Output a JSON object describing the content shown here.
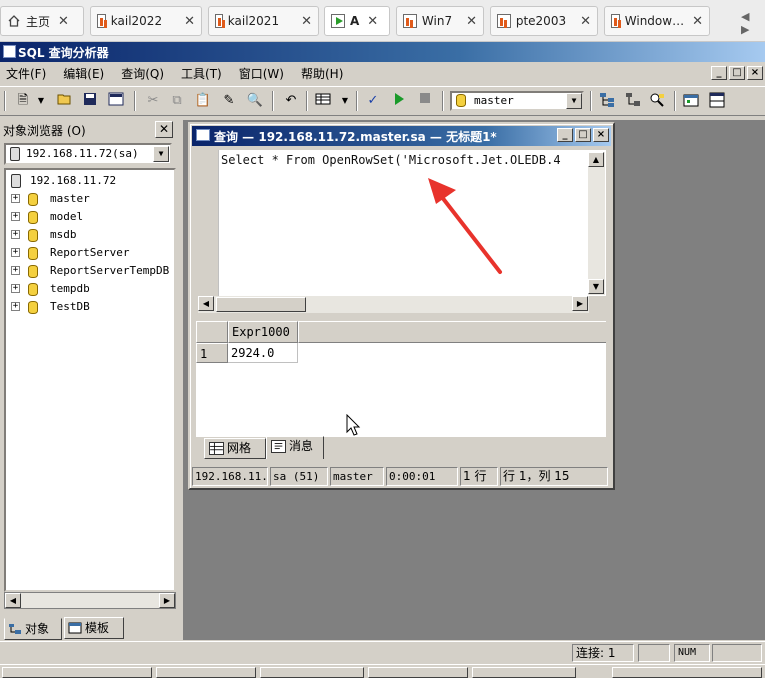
{
  "browser_tabs": [
    {
      "label": "主页",
      "icon": "home-icon",
      "active": false
    },
    {
      "label": "kail2022",
      "icon": "vm-icon",
      "active": false
    },
    {
      "label": "kail2021",
      "icon": "vm-icon",
      "active": false
    },
    {
      "label": "A",
      "icon": "play-icon",
      "active": true
    },
    {
      "label": "Win7",
      "icon": "vm-icon",
      "active": false
    },
    {
      "label": "pte2003",
      "icon": "vm-icon",
      "active": false
    },
    {
      "label": "Window…",
      "icon": "vm-icon",
      "active": false
    }
  ],
  "app": {
    "title": "SQL 查询分析器",
    "window_buttons": [
      "_",
      "□",
      "×"
    ]
  },
  "menu": [
    "文件(F)",
    "编辑(E)",
    "查询(Q)",
    "工具(T)",
    "窗口(W)",
    "帮助(H)"
  ],
  "toolbar": {
    "database": "master",
    "buttons": [
      "new-query-icon",
      "open-icon",
      "save-icon",
      "save-all-icon",
      "cut-icon",
      "copy-icon",
      "paste-icon",
      "edit-icon",
      "find-icon",
      "undo-icon",
      "results-mode-icon",
      "parse-icon",
      "execute-icon",
      "stop-icon",
      "object-browser-icon",
      "object-search-icon",
      "execution-plan-icon",
      "options-icon",
      "results-pane-icon"
    ]
  },
  "object_browser": {
    "title": "对象浏览器 (O)",
    "server_combo": "192.168.11.72(sa)",
    "server": "192.168.11.72",
    "databases": [
      "master",
      "model",
      "msdb",
      "ReportServer",
      "ReportServerTempDB",
      "tempdb",
      "TestDB"
    ],
    "tabs": [
      "对象",
      "模板"
    ]
  },
  "query_window": {
    "title": "查询 — 192.168.11.72.master.sa — 无标题1*",
    "sql": "Select * From OpenRowSet('Microsoft.Jet.OLEDB.4",
    "results": {
      "columns": [
        "Expr1000"
      ],
      "rows": [
        {
          "num": "1",
          "values": [
            "2924.0"
          ]
        }
      ]
    },
    "result_tabs": [
      "网格",
      "消息"
    ],
    "status": {
      "server": "192.168.11.",
      "user": "sa (51)",
      "database": "master",
      "elapsed": "0:00:01",
      "rows": "1 行",
      "position": "行 1，列 15"
    }
  },
  "app_status": {
    "connections": "连接: 1",
    "num": "NUM"
  },
  "colors": {
    "title_gradient_start": "#0a246a",
    "title_gradient_end": "#a6caf0",
    "arrow": "#e8332c",
    "chrome": "#d4d0c8",
    "mdi_background": "#808080"
  }
}
